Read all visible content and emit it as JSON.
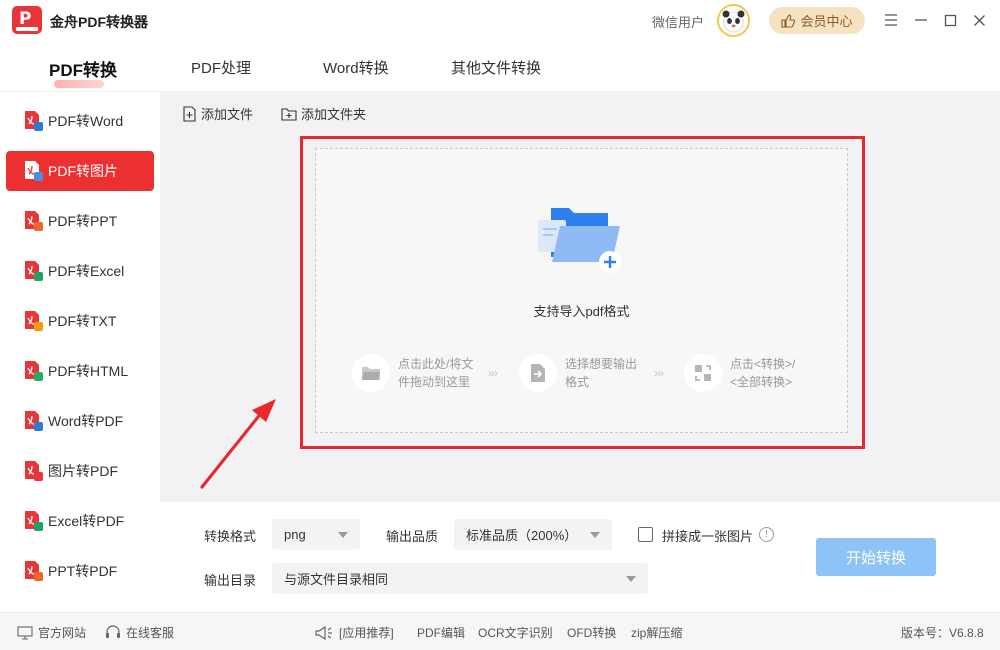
{
  "app": {
    "title": "金舟PDF转换器",
    "user_name": "微信用户",
    "vip_label": "会员中心"
  },
  "tabs": [
    {
      "label": "PDF转换",
      "active": true
    },
    {
      "label": "PDF处理"
    },
    {
      "label": "Word转换"
    },
    {
      "label": "其他文件转换"
    }
  ],
  "sidebar": {
    "items": [
      {
        "label": "PDF转Word",
        "icon": "pdf-to-word-icon",
        "badge": "W",
        "badge_color": "#2b7cd3"
      },
      {
        "label": "PDF转图片",
        "icon": "pdf-to-image-icon",
        "badge": "▲",
        "badge_color": "#4a90e2",
        "active": true
      },
      {
        "label": "PDF转PPT",
        "icon": "pdf-to-ppt-icon",
        "badge": "P",
        "badge_color": "#e8692a"
      },
      {
        "label": "PDF转Excel",
        "icon": "pdf-to-excel-icon",
        "badge": "X",
        "badge_color": "#21a366"
      },
      {
        "label": "PDF转TXT",
        "icon": "pdf-to-txt-icon",
        "badge": "T",
        "badge_color": "#f39c12"
      },
      {
        "label": "PDF转HTML",
        "icon": "pdf-to-html-icon",
        "badge": "</>",
        "badge_color": "#27ae60"
      },
      {
        "label": "Word转PDF",
        "icon": "word-to-pdf-icon",
        "badge": "W",
        "badge_color": "#2b7cd3"
      },
      {
        "label": "图片转PDF",
        "icon": "image-to-pdf-icon",
        "badge": "P",
        "badge_color": "#e8353a"
      },
      {
        "label": "Excel转PDF",
        "icon": "excel-to-pdf-icon",
        "badge": "X",
        "badge_color": "#21a366"
      },
      {
        "label": "PPT转PDF",
        "icon": "ppt-to-pdf-icon",
        "badge": "P",
        "badge_color": "#e8692a"
      }
    ]
  },
  "toolbar": {
    "add_file": "添加文件",
    "add_folder": "添加文件夹"
  },
  "dropzone": {
    "hint": "支持导入pdf格式",
    "steps": [
      {
        "line1": "点击此处/将文",
        "line2": "件拖动到这里"
      },
      {
        "line1": "选择想要输出",
        "line2": "格式"
      },
      {
        "line1": "点击<转换>/",
        "line2": "<全部转换>"
      }
    ],
    "arrow_text": "›››"
  },
  "settings": {
    "format_label": "转换格式",
    "format_value": "png",
    "quality_label": "输出品质",
    "quality_value": "标准品质（200%）",
    "merge_label": "拼接成一张图片",
    "info_glyph": "!",
    "output_label": "输出目录",
    "output_value": "与源文件目录相同",
    "start_label": "开始转换"
  },
  "footer": {
    "website": "官方网站",
    "support": "在线客服",
    "app_recommend": "[应用推荐]",
    "links": [
      "PDF编辑",
      "OCR文字识别",
      "OFD转换",
      "zip解压缩"
    ],
    "version": "版本号：V6.8.8"
  },
  "colors": {
    "accent_red": "#ec2f31",
    "start_button": "#8ec3f7",
    "vip_bg": "#f6e1c1",
    "folder_blue": "#2e7ff0"
  }
}
